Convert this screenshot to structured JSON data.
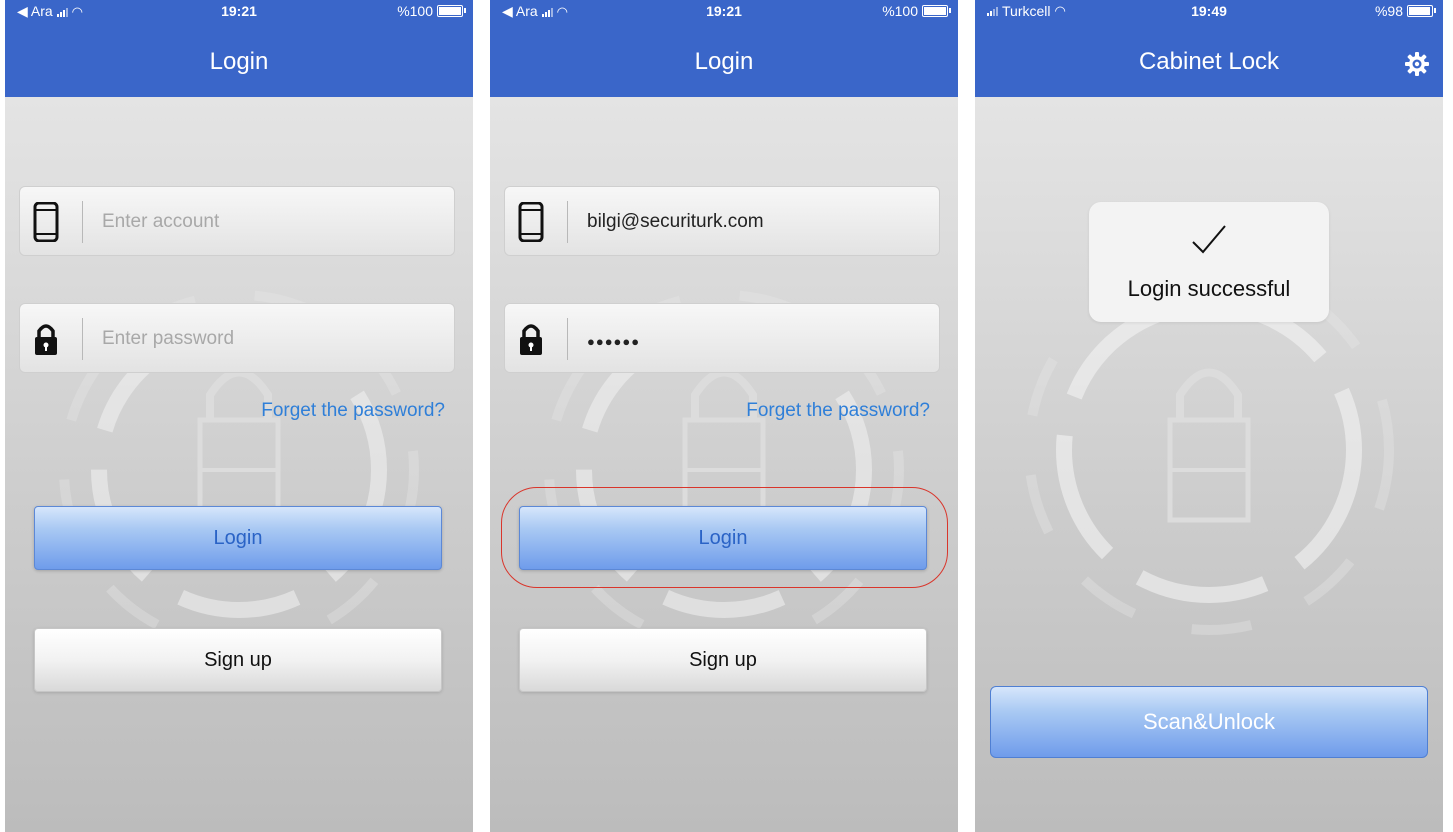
{
  "screens": [
    {
      "status": {
        "carrier": "◀ Ara",
        "time": "19:21",
        "battery": "%100",
        "battery_level": 1.0
      },
      "nav_title": "Login",
      "account_placeholder": "Enter account",
      "password_placeholder": "Enter password",
      "forgot_label": "Forget the password?",
      "login_label": "Login",
      "signup_label": "Sign up"
    },
    {
      "status": {
        "carrier": "◀ Ara",
        "time": "19:21",
        "battery": "%100",
        "battery_level": 1.0
      },
      "nav_title": "Login",
      "account_value": "bilgi@securiturk.com",
      "password_value": "●●●●●●",
      "forgot_label": "Forget the password?",
      "login_label": "Login",
      "signup_label": "Sign up"
    },
    {
      "status": {
        "carrier": "Turkcell",
        "time": "19:49",
        "battery": "%98",
        "battery_level": 0.98
      },
      "nav_title": "Cabinet Lock",
      "toast_message": "Login successful",
      "scan_label": "Scan&Unlock"
    }
  ],
  "icons": {
    "phone": "phone-icon",
    "lock": "lock-icon",
    "gear": "gear-icon",
    "check": "checkmark-icon",
    "signal": "signal-icon",
    "wifi": "wifi-icon",
    "battery": "battery-icon"
  },
  "colors": {
    "nav_blue": "#3a66c9",
    "link_blue": "#2f7fd8",
    "highlight_red": "#d9352b"
  }
}
